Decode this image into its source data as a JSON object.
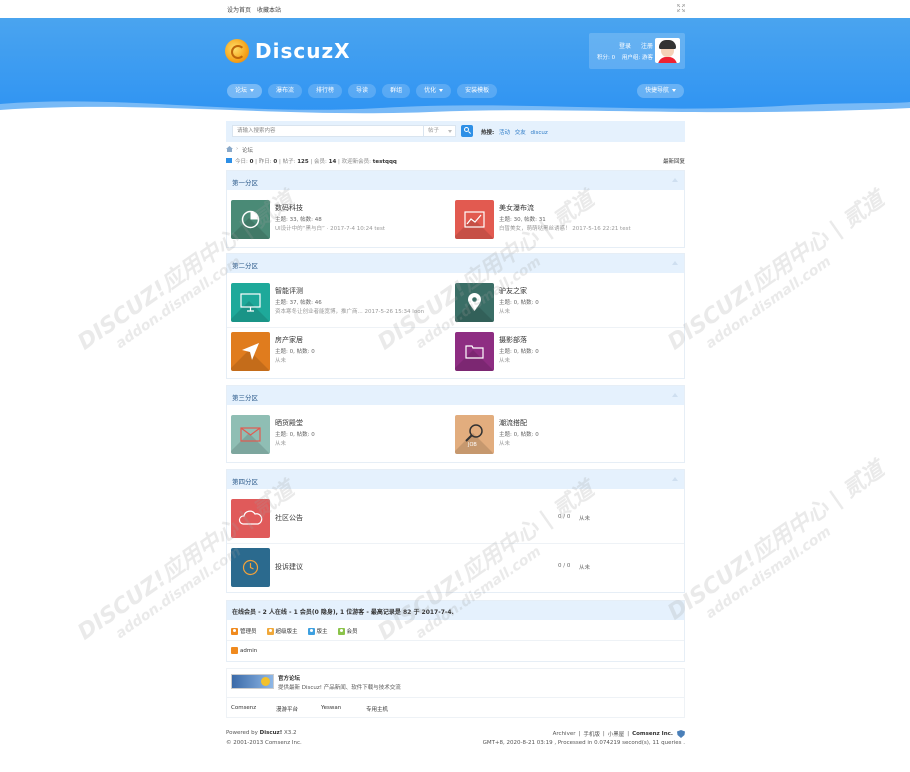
{
  "topbar": {
    "set_home": "设为首页",
    "bookmark": "收藏本站"
  },
  "brand": {
    "logo_text": "DiscuzX",
    "colors": {
      "header": "#2e93f3",
      "accent": "#2d8fe6"
    }
  },
  "user": {
    "login": "登录",
    "register": "注册",
    "credits": "积分: 0",
    "group": "用户组: 游客"
  },
  "nav": {
    "items": [
      {
        "label": "论坛",
        "caret": true
      },
      {
        "label": "瀑布流"
      },
      {
        "label": "排行榜"
      },
      {
        "label": "导读"
      },
      {
        "label": "群组"
      },
      {
        "label": "优化",
        "caret": true
      },
      {
        "label": "安装模板"
      }
    ],
    "quick": "快捷导航"
  },
  "search": {
    "placeholder": "请输入搜索内容",
    "type": "帖子",
    "hot_label": "热搜:",
    "hot": [
      "活动",
      "交友",
      "discuz"
    ]
  },
  "breadcrumb": {
    "label": "论坛"
  },
  "stats": {
    "today_label": "今日:",
    "today": "0",
    "yesterday_label": "昨日:",
    "yesterday": "0",
    "posts_label": "帖子:",
    "posts": "125",
    "members_label": "会员:",
    "members": "14",
    "welcome": "欢迎新会员:",
    "newuser": "testqqq",
    "latest": "最新回复"
  },
  "sections": [
    {
      "title": "第一分区",
      "forums": [
        {
          "name": "数码科技",
          "meta": "主题: 33, 帖数: 48",
          "last": "UI设计中的“黑与白” · 2017-7-4 10:24 test",
          "color": "#4a8a76",
          "icon": "pie-chart-icon"
        },
        {
          "name": "美女瀑布流",
          "meta": "主题: 30, 帖数: 31",
          "last": "白皙美女，萌萌哒黑丝诱惑！ 2017-5-16 22:21 test",
          "color": "#e25a50",
          "icon": "line-chart-icon"
        }
      ]
    },
    {
      "title": "第二分区",
      "forums": [
        {
          "name": "智能评测",
          "meta": "主题: 37, 帖数: 46",
          "last": "资本寒冬让创业者能宽博，推广商... 2017-5-26 15:34 loon",
          "color": "#1ea99a",
          "icon": "monitor-icon"
        },
        {
          "name": "驴友之家",
          "meta": "主题: 0, 帖数: 0",
          "last": "从未",
          "color": "#3a6e66",
          "icon": "location-pin-icon"
        },
        {
          "name": "房产家居",
          "meta": "主题: 0, 帖数: 0",
          "last": "从未",
          "color": "#e07c1e",
          "icon": "paper-plane-icon"
        },
        {
          "name": "摄影部落",
          "meta": "主题: 0, 帖数: 0",
          "last": "从未",
          "color": "#8e2d82",
          "icon": "folder-icon"
        }
      ]
    },
    {
      "title": "第三分区",
      "forums": [
        {
          "name": "晒货殿堂",
          "meta": "主题: 0, 帖数: 0",
          "last": "从未",
          "color": "#8fbeb4",
          "icon": "mail-icon"
        },
        {
          "name": "潮流搭配",
          "meta": "主题: 0, 帖数: 0",
          "last": "从未",
          "color": "#e2ad7e",
          "icon": "job-search-icon"
        }
      ]
    },
    {
      "title": "第四分区",
      "forums": [
        {
          "name": "社区公告",
          "count": "0 / 0",
          "last": "从未",
          "color": "#e05a5a",
          "icon": "cloud-icon"
        },
        {
          "name": "投诉建议",
          "count": "0 / 0",
          "last": "从未",
          "color": "#2b6a8e",
          "icon": "clock-icon"
        }
      ]
    }
  ],
  "online": {
    "title": "在线会员 - 2 人在线 - 1 会员(0 隐身), 1 位游客 - 最高记录是 82 于 2017-7-4.",
    "legend": [
      {
        "label": "管理员",
        "color": "#f08a1e"
      },
      {
        "label": "超级版主",
        "color": "#f0a83a"
      },
      {
        "label": "版主",
        "color": "#3ea0e0"
      },
      {
        "label": "会员",
        "color": "#8bc34a"
      }
    ],
    "user": "admin"
  },
  "links": {
    "official_title": "官方论坛",
    "official_desc": "提供最新 Discuz! 产品新闻、软件下载与技术交流",
    "text_links": [
      "Comsenz",
      "漫游平台",
      "Yeswan",
      "专用主机"
    ]
  },
  "footer": {
    "powered": "Powered by",
    "product": "Discuz!",
    "version": "X3.2",
    "copyright": "© 2001-2013 Comsenz Inc.",
    "right_links": [
      "Archiver",
      "|",
      "手机版",
      "|",
      "小黑屋",
      "|"
    ],
    "company": "Comsenz Inc.",
    "processed": "GMT+8, 2020-8-21 03:19 , Processed in 0.074219 second(s), 11 queries ."
  }
}
